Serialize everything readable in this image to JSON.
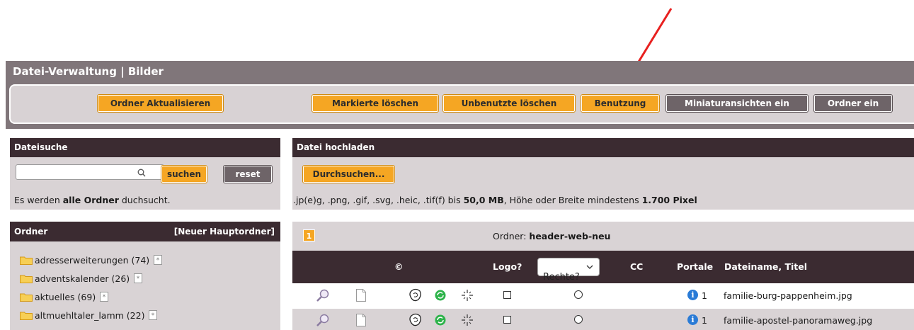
{
  "window": {
    "title": "Datei-Verwaltung | Bilder"
  },
  "toolbar": {
    "refresh_label": "Ordner Aktualisieren",
    "delete_marked_label": "Markierte löschen",
    "delete_unused_label": "Unbenutzte löschen",
    "usage_label": "Benutzung",
    "thumbnails_label": "Miniaturansichten ein",
    "folders_label": "Ordner ein"
  },
  "search": {
    "heading": "Dateisuche",
    "value": "",
    "submit_label": "suchen",
    "reset_label": "reset",
    "note_prefix": "Es werden ",
    "note_bold": "alle Ordner",
    "note_suffix": " duchsucht."
  },
  "upload": {
    "heading": "Datei hochladen",
    "browse_label": "Durchsuchen...",
    "formats_text": ".jp(e)g, .png, .gif, .svg, .heic, .tif(f) bis ",
    "max_size": "50,0 MB",
    "dims_text": ", Höhe oder Breite mindestens ",
    "min_pixels": "1.700 Pixel"
  },
  "folders": {
    "heading": "Ordner",
    "new_root_label": "[Neuer Hauptordner]",
    "items": [
      {
        "label": "adresserweiterungen (74)"
      },
      {
        "label": "adventskalender (26)"
      },
      {
        "label": "aktuelles (69)"
      },
      {
        "label": "altmuehltaler_lamm (22)"
      }
    ]
  },
  "file_list": {
    "page_number": "1",
    "folder_prefix": "Ordner: ",
    "folder_name": "header-web-neu",
    "columns": {
      "copyright": "©",
      "logo": "Logo?",
      "rechte": "Rechte?",
      "cc": "CC",
      "portale": "Portale",
      "filename": "Dateiname, Titel"
    },
    "rows": [
      {
        "portale_count": "1",
        "filename": "familie-burg-pappenheim.jpg"
      },
      {
        "portale_count": "1",
        "filename": "familie-apostel-panoramaweg.jpg"
      }
    ]
  },
  "colors": {
    "accent_orange": "#f5a623",
    "dark_button": "#6e6468",
    "header_bar": "#3b2b31",
    "panel_bg": "#d9d3d5",
    "outer_bar": "#80767a",
    "arrow": "#e8201f",
    "info_blue": "#2a7bd6",
    "refresh_green": "#2db34a"
  },
  "icons": {
    "search": "magnifier-icon",
    "folder": "folder-icon",
    "new": "new-subfolder-icon",
    "preview": "zoom-preview-icon",
    "document": "document-icon",
    "copyright": "copyright-icon",
    "refresh": "refresh-icon",
    "focus": "focus-point-icon",
    "info": "info-icon"
  }
}
